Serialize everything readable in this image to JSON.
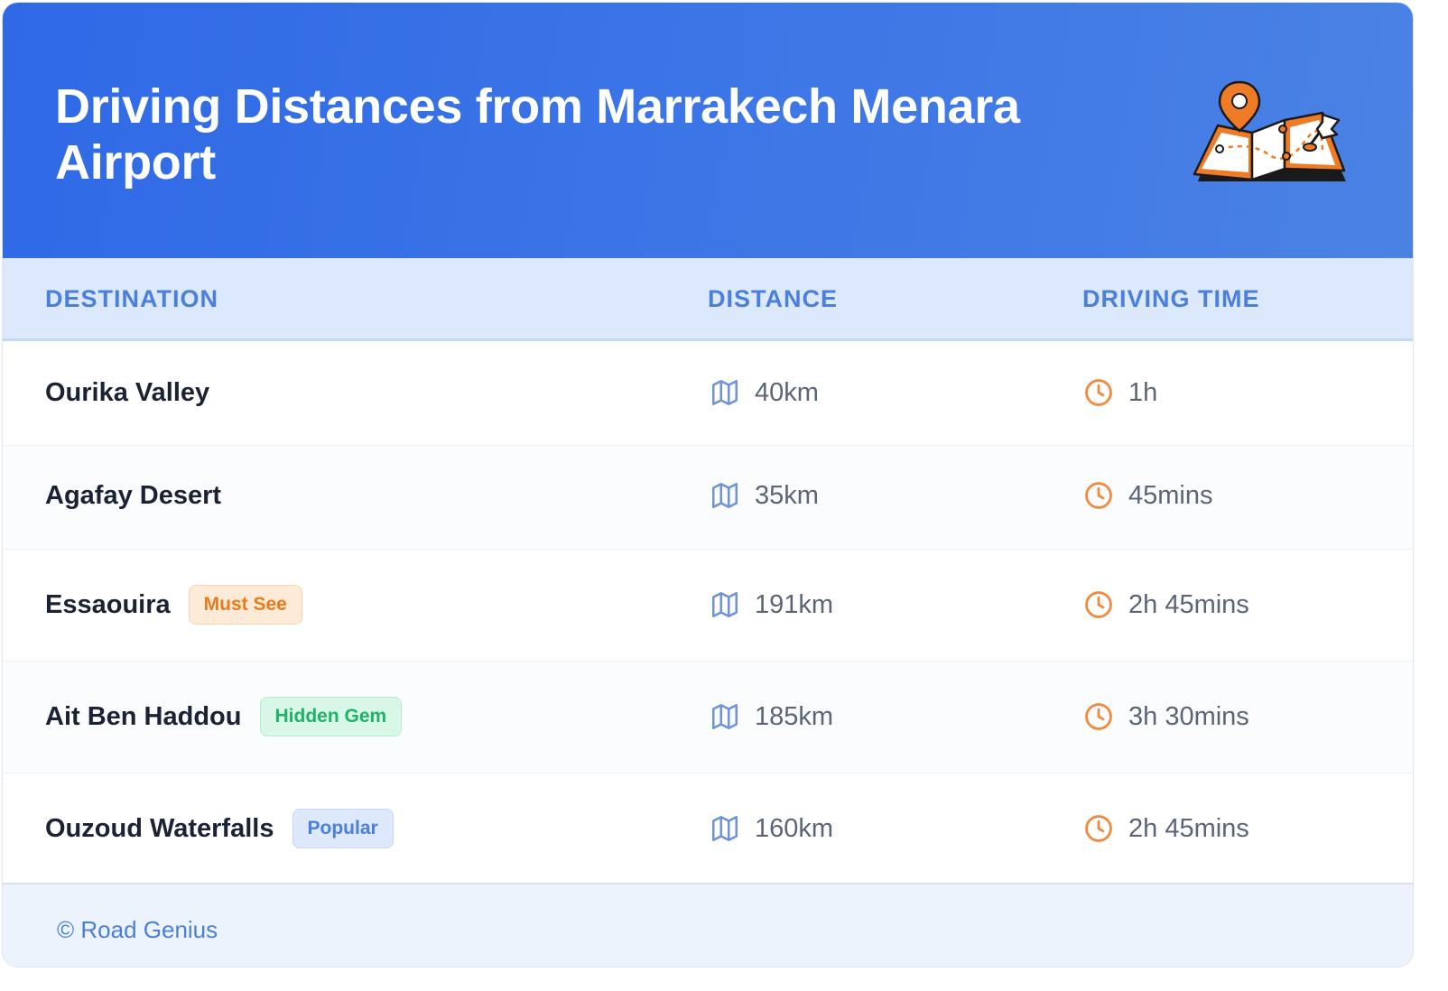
{
  "header": {
    "title": "Driving Distances from Marrakech Menara Airport",
    "background_color": "#2f69e6",
    "illustration_icon": "map-pin-illustration"
  },
  "table": {
    "columns": [
      "DESTINATION",
      "DISTANCE",
      "DRIVING TIME"
    ],
    "rows": [
      {
        "destination": "Ourika Valley",
        "badge": "",
        "distance": "40km",
        "time": "1h"
      },
      {
        "destination": "Agafay Desert",
        "badge": "",
        "distance": "35km",
        "time": "45mins"
      },
      {
        "destination": "Essaouira",
        "badge": "Must See",
        "badge_color": "#ec7a1c",
        "distance": "191km",
        "time": "2h 45mins"
      },
      {
        "destination": "Ait Ben Haddou",
        "badge": "Hidden Gem",
        "badge_color": "#1fb36a",
        "distance": "185km",
        "time": "3h 30mins"
      },
      {
        "destination": "Ouzoud Waterfalls",
        "badge": "Popular",
        "badge_color": "#4b7fdc",
        "distance": "160km",
        "time": "2h 45mins"
      }
    ],
    "distance_icon": "map-icon",
    "time_icon": "clock-icon"
  },
  "footer": {
    "credit": "© Road Genius"
  }
}
